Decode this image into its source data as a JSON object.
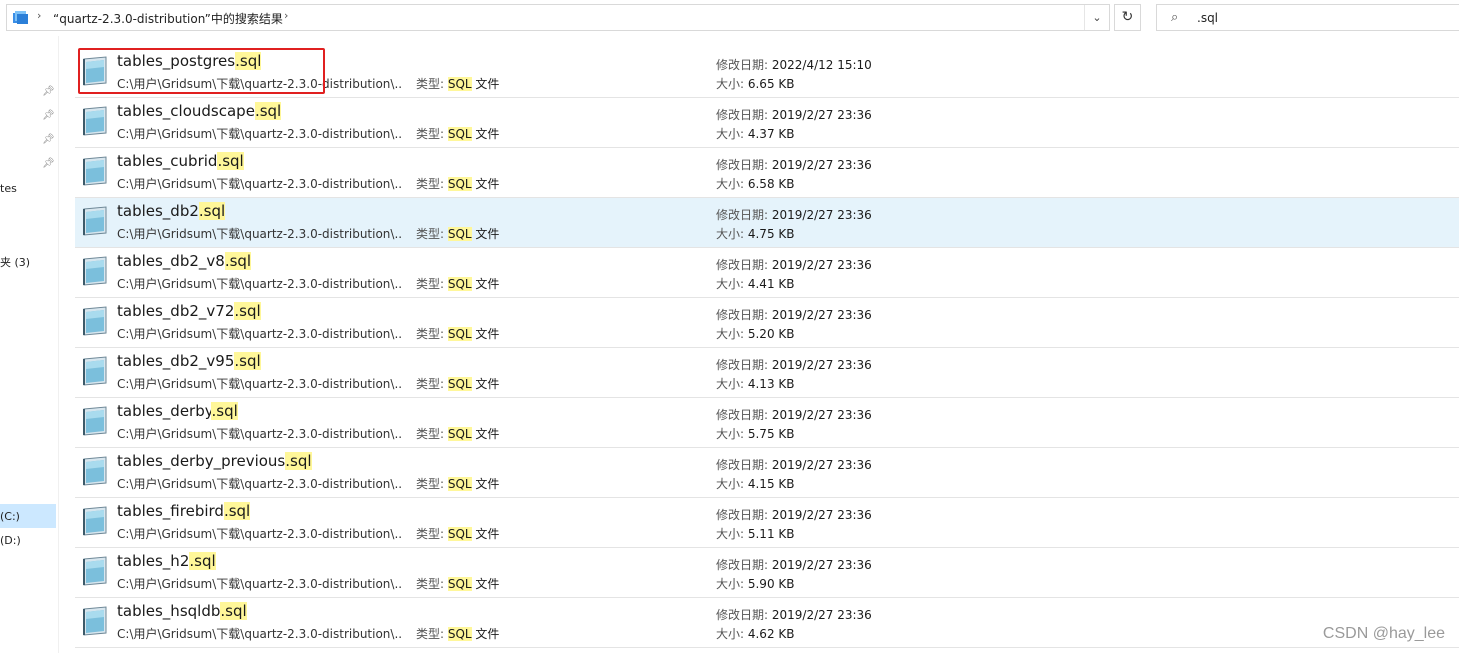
{
  "address_bar": {
    "breadcrumb_separator": "›",
    "path_text": "“quartz-2.3.0-distribution”中的搜索结果",
    "dropdown_glyph": "⌄",
    "refresh_glyph": "↻"
  },
  "search": {
    "icon_glyph": "⌕",
    "query": ".sql"
  },
  "nav": {
    "items": [
      {
        "label": "tes"
      },
      {
        "label": "夹 (3)"
      },
      {
        "label": "(C:)"
      },
      {
        "label": "(D:)"
      }
    ]
  },
  "labels": {
    "type_label": "类型: ",
    "type_value": "SQL",
    "type_suffix": " 文件",
    "date_label": "修改日期: ",
    "size_label": "大小: "
  },
  "files": [
    {
      "name": "tables_postgres",
      "ext": ".sql",
      "path": "C:\\用户\\Gridsum\\下载\\quartz-2.3.0-distribution\\...",
      "date": "2022/4/12 15:10",
      "size": "6.65 KB"
    },
    {
      "name": "tables_cloudscape",
      "ext": ".sql",
      "path": "C:\\用户\\Gridsum\\下载\\quartz-2.3.0-distribution\\...",
      "date": "2019/2/27 23:36",
      "size": "4.37 KB"
    },
    {
      "name": "tables_cubrid",
      "ext": ".sql",
      "path": "C:\\用户\\Gridsum\\下载\\quartz-2.3.0-distribution\\...",
      "date": "2019/2/27 23:36",
      "size": "6.58 KB"
    },
    {
      "name": "tables_db2",
      "ext": ".sql",
      "path": "C:\\用户\\Gridsum\\下载\\quartz-2.3.0-distribution\\...",
      "date": "2019/2/27 23:36",
      "size": "4.75 KB"
    },
    {
      "name": "tables_db2_v8",
      "ext": ".sql",
      "path": "C:\\用户\\Gridsum\\下载\\quartz-2.3.0-distribution\\...",
      "date": "2019/2/27 23:36",
      "size": "4.41 KB"
    },
    {
      "name": "tables_db2_v72",
      "ext": ".sql",
      "path": "C:\\用户\\Gridsum\\下载\\quartz-2.3.0-distribution\\...",
      "date": "2019/2/27 23:36",
      "size": "5.20 KB"
    },
    {
      "name": "tables_db2_v95",
      "ext": ".sql",
      "path": "C:\\用户\\Gridsum\\下载\\quartz-2.3.0-distribution\\...",
      "date": "2019/2/27 23:36",
      "size": "4.13 KB"
    },
    {
      "name": "tables_derby",
      "ext": ".sql",
      "path": "C:\\用户\\Gridsum\\下载\\quartz-2.3.0-distribution\\...",
      "date": "2019/2/27 23:36",
      "size": "5.75 KB"
    },
    {
      "name": "tables_derby_previous",
      "ext": ".sql",
      "path": "C:\\用户\\Gridsum\\下载\\quartz-2.3.0-distribution\\...",
      "date": "2019/2/27 23:36",
      "size": "4.15 KB"
    },
    {
      "name": "tables_firebird",
      "ext": ".sql",
      "path": "C:\\用户\\Gridsum\\下载\\quartz-2.3.0-distribution\\...",
      "date": "2019/2/27 23:36",
      "size": "5.11 KB"
    },
    {
      "name": "tables_h2",
      "ext": ".sql",
      "path": "C:\\用户\\Gridsum\\下载\\quartz-2.3.0-distribution\\...",
      "date": "2019/2/27 23:36",
      "size": "5.90 KB"
    },
    {
      "name": "tables_hsqldb",
      "ext": ".sql",
      "path": "C:\\用户\\Gridsum\\下载\\quartz-2.3.0-distribution\\...",
      "date": "2019/2/27 23:36",
      "size": "4.62 KB"
    }
  ],
  "colors": {
    "highlight": "#fff799",
    "hover_row": "#e5f3fb",
    "annotation_box": "#e02020",
    "nav_selected": "#cce8ff"
  },
  "watermark": "CSDN @hay_lee"
}
